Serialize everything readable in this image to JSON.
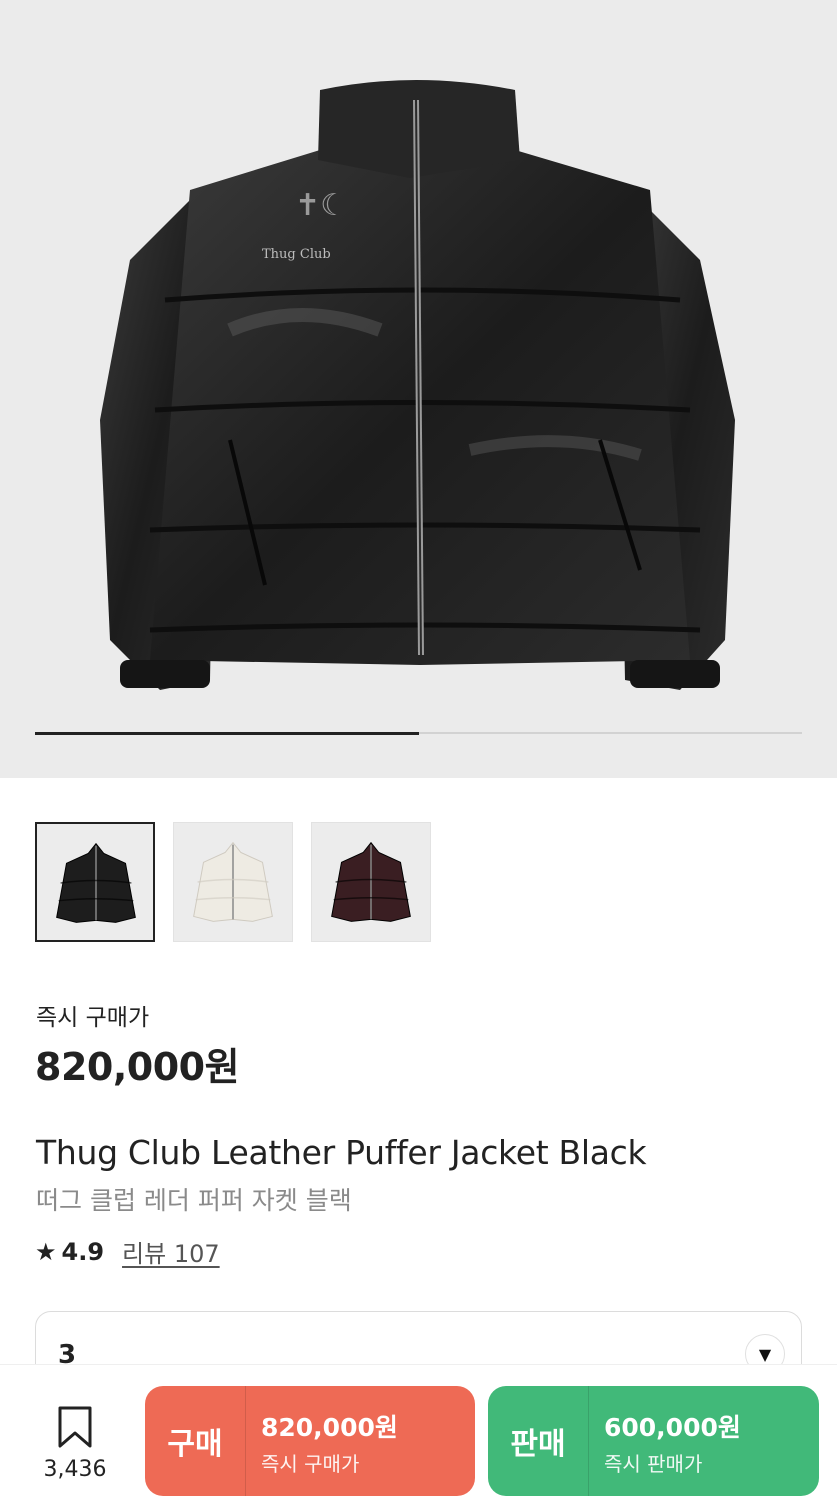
{
  "product": {
    "image_alt": "Thug Club",
    "image_progress": 0.5,
    "thumbnails": [
      {
        "color": "#1d1d1d",
        "selected": true
      },
      {
        "color": "#eeebe3",
        "selected": false
      },
      {
        "color": "#3a1e22",
        "selected": false
      }
    ],
    "price_label": "즉시 구매가",
    "price": "820,000원",
    "title_en": "Thug Club Leather Puffer Jacket Black",
    "title_ko": "떠그 클럽 레더 퍼퍼 자켓 블랙",
    "rating": "4.9",
    "review_label": "리뷰 107"
  },
  "size_select": {
    "value": "3"
  },
  "bottom_bar": {
    "wish_count": "3,436",
    "buy": {
      "kind": "구매",
      "amount": "820,000원",
      "sub": "즉시 구매가",
      "color": "#ee6a55"
    },
    "sell": {
      "kind": "판매",
      "amount": "600,000원",
      "sub": "즉시 판매가",
      "color": "#41b979"
    }
  }
}
